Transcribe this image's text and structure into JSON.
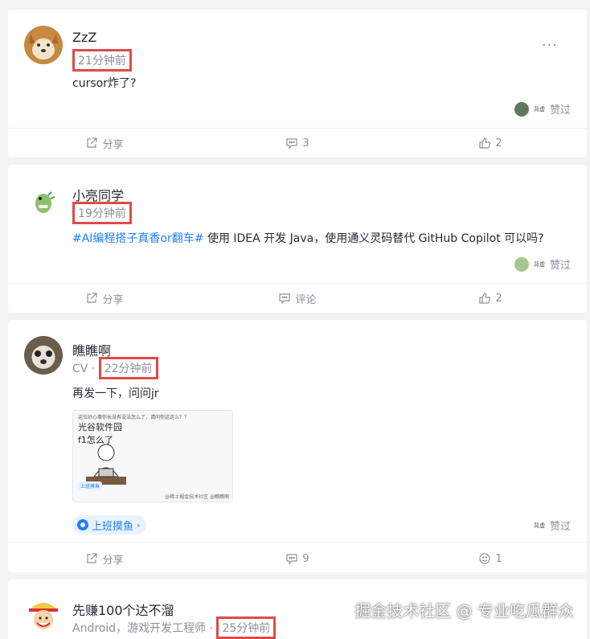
{
  "posts": [
    {
      "username": "ZzZ",
      "meta_prefix": "",
      "time": "21分钟前",
      "content_topic": "",
      "content_text": "cursor炸了?",
      "liker_label": "背虚",
      "liked_label": "赞过",
      "share_label": "分享",
      "comment_label": "3",
      "like_label": "2"
    },
    {
      "username": "小亮同学",
      "meta_prefix": "",
      "time": "19分钟前",
      "content_topic": "#AI编程搭子真香or翻车#",
      "content_text": " 使用 IDEA 开发 Java，使用通义灵码替代 GitHub Copilot 可以吗?",
      "liker_label": "背虚",
      "liked_label": "赞过",
      "share_label": "分享",
      "comment_label": "评论",
      "like_label": "2"
    },
    {
      "username": "瞧瞧啊",
      "meta_prefix": "CV ·",
      "time": "22分钟前",
      "content_topic": "",
      "content_text": "再发一下，问问jr",
      "attachment": {
        "header": "这位好心事你长没有没法怎么了，请问你这这么？？",
        "line1": "光谷软件园",
        "line2": "f1怎么了",
        "tag": "上班摸鱼",
        "footer": "@稀土掘金技术社区 @瞧瞧啊"
      },
      "circle_label": "上班摸鱼",
      "liker_label": "背虚",
      "liked_label": "赞过",
      "share_label": "分享",
      "comment_label": "9",
      "like_label": "1"
    },
    {
      "username": "先赚100个达不溜",
      "meta_prefix": "Android，游戏开发工程师 ·",
      "time": "25分钟前"
    }
  ],
  "more_label": "···",
  "watermark": "掘金技术社区 @ 专业吃瓜群众",
  "colors": {
    "accent": "#1e80ff",
    "highlight_box": "#e04a4a",
    "muted": "#8a919f"
  }
}
